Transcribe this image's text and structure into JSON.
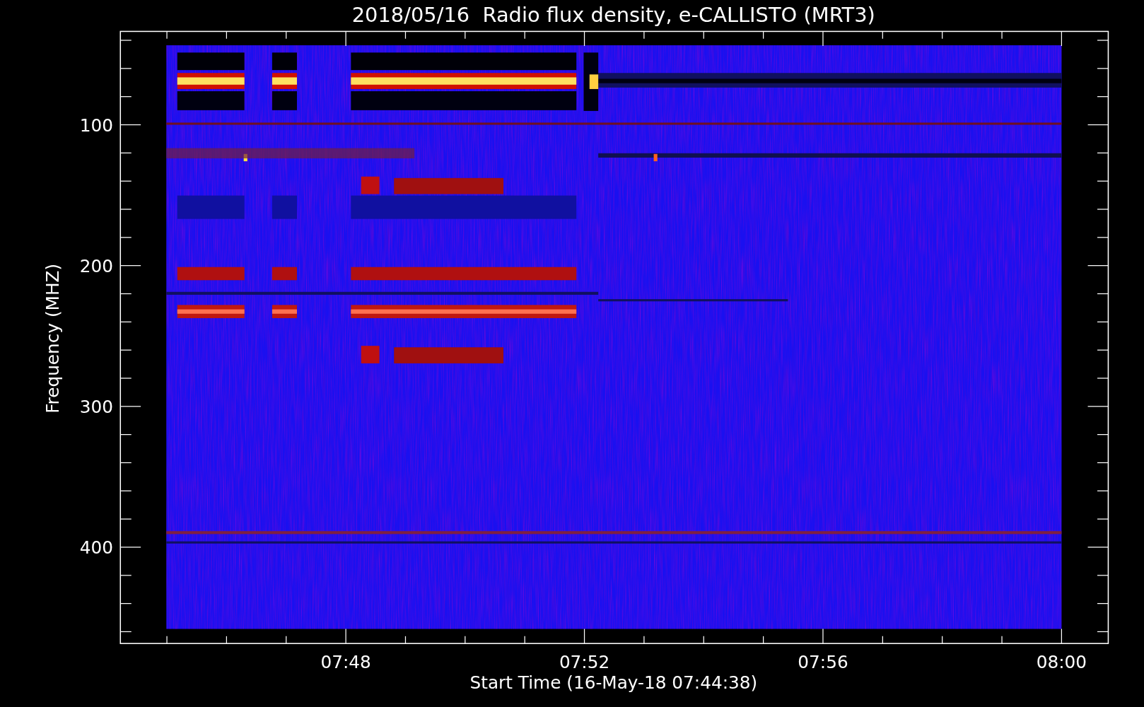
{
  "title": "2018/05/16  Radio flux density, e-CALLISTO (MRT3)",
  "plot": {
    "ylabel": "Frequency (MHZ)",
    "xlabel": "Start Time (16-May-18 07:44:38)",
    "yticks": [
      "100",
      "200",
      "300",
      "400"
    ],
    "xticks": [
      "07:48",
      "07:52",
      "07:56",
      "08:00"
    ]
  }
}
